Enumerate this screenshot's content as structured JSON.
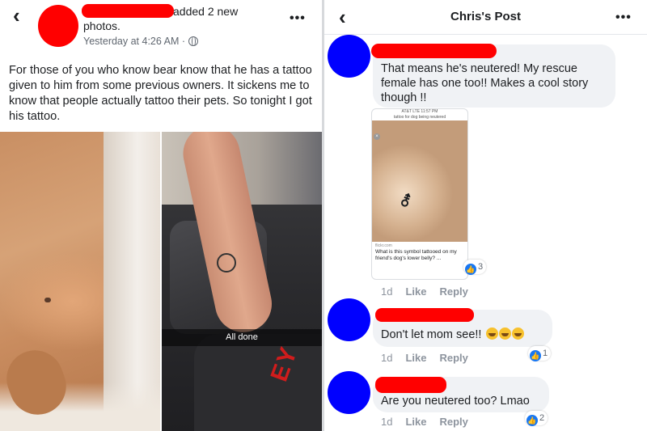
{
  "left_post": {
    "action_text": "added 2 new",
    "action_text2": "photos.",
    "timestamp": "Yesterday at 4:26 AM ·",
    "body": "For those of you who know bear know that he has a tattoo given to him from some previous owners. It sickens me to know that people actually tattoo their pets. So tonight I got his tattoo.",
    "photo2_caption": "All done",
    "back_icon": "‹",
    "more_icon": "•••"
  },
  "right_post": {
    "title": "Chris's Post",
    "back_icon": "‹",
    "more_icon": "•••",
    "comments": [
      {
        "text": "That means he's neutered!  My rescue female has one too!!  Makes a cool story though !!",
        "time": "1d",
        "like": "Like",
        "reply": "Reply",
        "reactions": "3",
        "shot": {
          "status": "AT&T LTE   11:57 PM",
          "search": "tattoo for dog being neutered",
          "source": "flickr.com",
          "question": "What is this symbol tattooed on my friend's dog's lower belly? ..."
        }
      },
      {
        "text": "Don't let mom see!!",
        "time": "1d",
        "like": "Like",
        "reply": "Reply",
        "reactions": "1"
      },
      {
        "text": "Are you neutered too? Lmao",
        "time": "1d",
        "like": "Like",
        "reply": "Reply",
        "reactions": "2"
      }
    ]
  },
  "colors": {
    "redaction": "#ff0000",
    "avatar": "#0000ff",
    "bubble": "#f0f2f5",
    "like_blue": "#1877f2"
  }
}
